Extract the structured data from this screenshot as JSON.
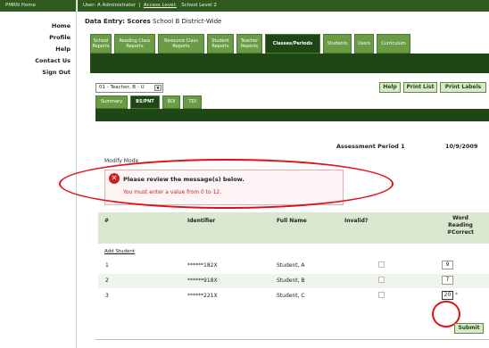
{
  "sidebar": {
    "header": "PMRN Home",
    "items": [
      "Home",
      "Profile",
      "Help",
      "Contact Us",
      "Sign Out"
    ]
  },
  "topbar": {
    "user": "User: A Administrator",
    "access_level": "Access Level:",
    "school_level": "School Level 2"
  },
  "page": {
    "title_prefix": "Data Entry: Scores",
    "title_suffix": "School B District-Wide"
  },
  "main_tabs": [
    "School\nReports",
    "Reading Class\nReports",
    "Resource Class\nReports",
    "Student\nReports",
    "Teacher\nReports",
    "Classes/Periods",
    "Students",
    "Users",
    "Curriculum"
  ],
  "controls": {
    "teacher_select": "01 - Teacher, B - U",
    "help": "Help",
    "print_list": "Print List",
    "print_labels": "Print Labels"
  },
  "sub_tabs": [
    "Summary",
    "BS/PNT",
    "BDI",
    "TDI"
  ],
  "assessment": {
    "label": "Assessment Period 1",
    "date": "10/9/2009"
  },
  "mode": "Modify Mode",
  "message": {
    "title": "Please review the message(s) below.",
    "body": "You must enter a value from 0 to 12."
  },
  "table": {
    "headers": {
      "num": "#",
      "identifier": "Identifier",
      "full_name": "Full Name",
      "invalid": "Invalid?",
      "word_line1": "Word",
      "word_line2": "Reading",
      "word_line3": "#Correct"
    },
    "add_student": "Add Student",
    "rows": [
      {
        "num": "1",
        "identifier": "******182X",
        "name": "Student, A",
        "value": "9",
        "star": ""
      },
      {
        "num": "2",
        "identifier": "******918X",
        "name": "Student, B",
        "value": "7",
        "star": ""
      },
      {
        "num": "3",
        "identifier": "******221X",
        "name": "Student, C",
        "value": "20",
        "star": "*"
      }
    ]
  },
  "submit": "Submit",
  "colors": {
    "dark_green": "#1f4715",
    "tab_green": "#6a9c45",
    "highlight_red": "#e0101a"
  }
}
